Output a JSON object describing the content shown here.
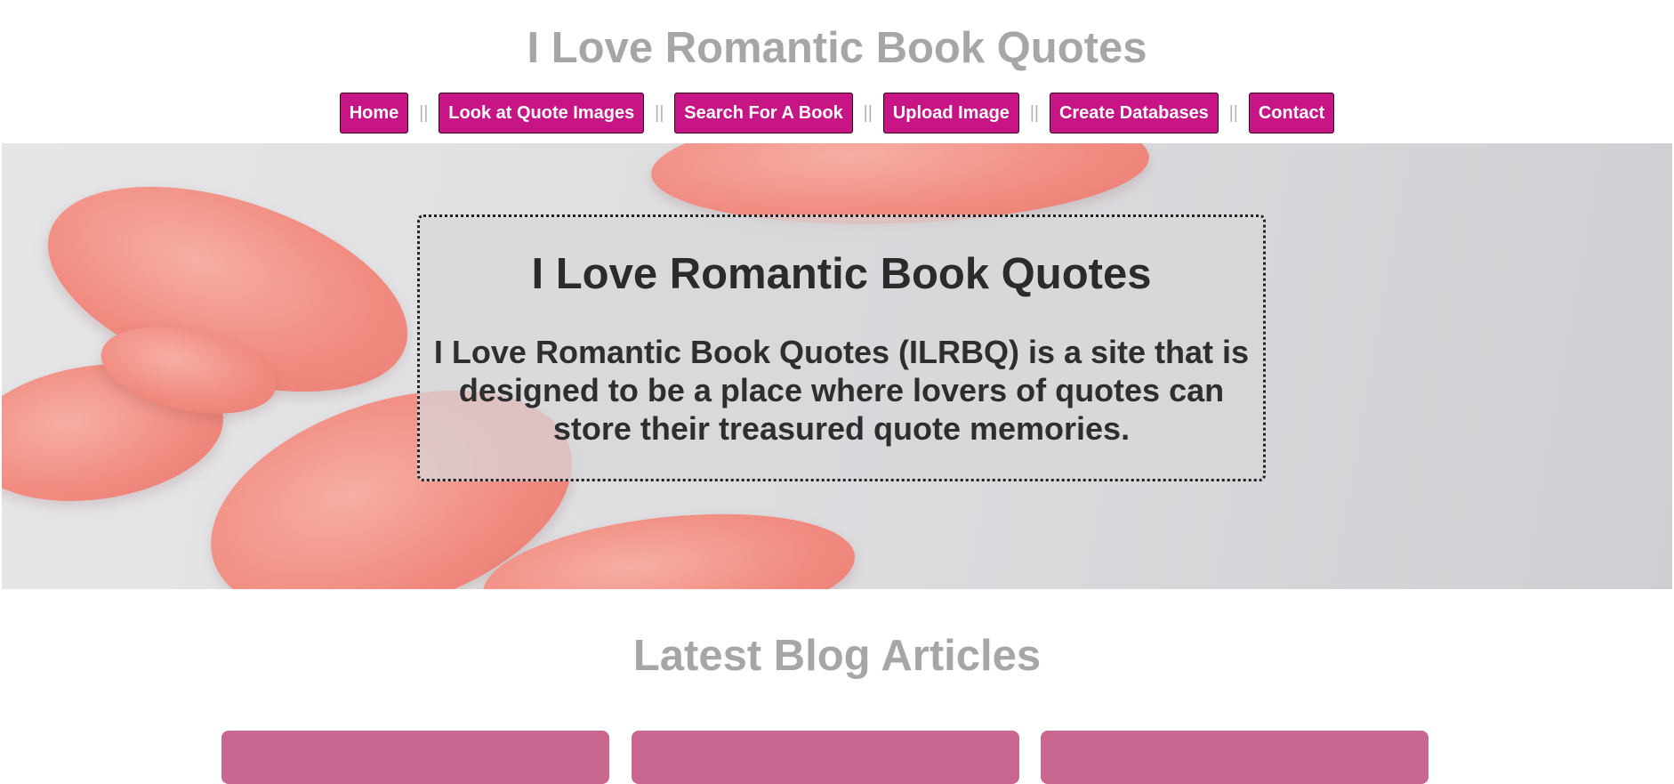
{
  "header": {
    "title": "I Love Romantic Book Quotes"
  },
  "nav": {
    "items": [
      {
        "label": "Home"
      },
      {
        "label": "Look at Quote Images"
      },
      {
        "label": "Search For A Book"
      },
      {
        "label": "Upload Image"
      },
      {
        "label": "Create Databases"
      },
      {
        "label": "Contact"
      }
    ],
    "separator": "||"
  },
  "hero": {
    "heading": "I Love Romantic Book Quotes",
    "text": "I Love Romantic Book Quotes (ILRBQ) is a site that is designed to be a place where lovers of quotes can store their treasured quote memories."
  },
  "blog": {
    "title": "Latest Blog Articles"
  },
  "colors": {
    "nav_button": "#c71585",
    "card": "#c96791",
    "title_gray": "#a6a6a6"
  }
}
